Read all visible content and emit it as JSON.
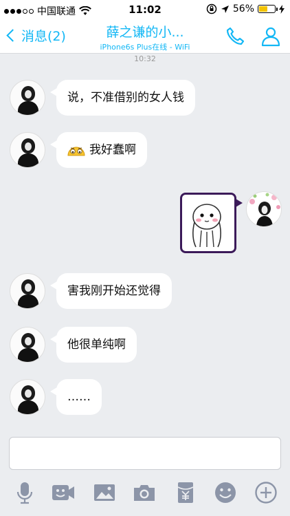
{
  "status_bar": {
    "carrier": "中国联通",
    "time": "11:02",
    "battery_percent": "56%",
    "battery_level": 0.56
  },
  "nav": {
    "back_label": "消息(2)",
    "title": "薛之谦的小...",
    "subtitle": "iPhone6s Plus在线 - WiFi"
  },
  "chat": {
    "timestamp": "10:32",
    "messages": [
      {
        "side": "left",
        "text": "说，不准借别的女人钱"
      },
      {
        "side": "left",
        "text": "我好蠢啊",
        "emoji": "awkward-face"
      },
      {
        "side": "right",
        "type": "sticker",
        "sticker": "blushing-doodle-sticker"
      },
      {
        "side": "left",
        "text": "害我刚开始还觉得"
      },
      {
        "side": "left",
        "text": "他很单纯啊"
      },
      {
        "side": "left",
        "text": "……"
      }
    ]
  },
  "input": {
    "placeholder": ""
  },
  "toolbar": {
    "icons": [
      "microphone-icon",
      "video-icon",
      "image-icon",
      "camera-icon",
      "red-packet-icon",
      "emoji-icon",
      "plus-icon"
    ]
  },
  "colors": {
    "accent": "#12b7f5",
    "background": "#ebedf0",
    "bubble": "#ffffff",
    "toolbar_icon": "#8c95a8"
  }
}
